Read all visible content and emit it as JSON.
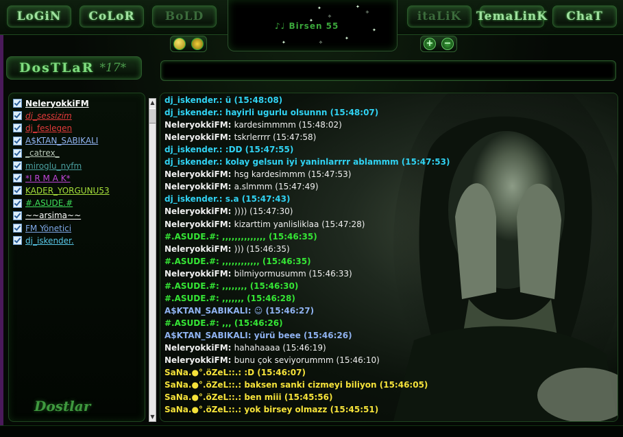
{
  "toolbar": {
    "login": "LoGiN",
    "color": "CoLoR",
    "bold": "BoLD",
    "italic": "itaLiK",
    "theme": "TemaLinK",
    "chat": "ChaT"
  },
  "logo": {
    "title": "♪♩ Birsen 55"
  },
  "room": {
    "label": "DosTLaR",
    "count": "*17*"
  },
  "message_input": {
    "value": ""
  },
  "brand": "Dostlar",
  "users": [
    {
      "name": "NeleryokkiFM",
      "color": "#ffffff",
      "bold": true
    },
    {
      "name": "dj_sessizim",
      "color": "#e23a3a",
      "italic": true
    },
    {
      "name": "dj_feslegen",
      "color": "#e23a3a"
    },
    {
      "name": "A$KTAN_SABIKALI",
      "color": "#8fb2f0"
    },
    {
      "name": "_catrex_",
      "color": "#b8c8b8"
    },
    {
      "name": "miroglu_nyfm",
      "color": "#4aa0a0"
    },
    {
      "name": "*I R M A K*",
      "color": "#c046d8"
    },
    {
      "name": "KADER_YORGUNU53",
      "color": "#a6e03a"
    },
    {
      "name": "#.ASUDE.#",
      "color": "#3ee05a"
    },
    {
      "name": "~~arsima~~",
      "color": "#ffffff"
    },
    {
      "name": "FM Yönetici",
      "color": "#7fa8e8"
    },
    {
      "name": "dj_iskender.",
      "color": "#58c8e8"
    }
  ],
  "messages": [
    {
      "user": "dj_iskender.:",
      "text": "ü (15:48:08)",
      "color": "#30d2f2"
    },
    {
      "user": "dj_iskender.:",
      "text": "hayirli ugurlu olsunnn (15:48:07)",
      "color": "#30d2f2"
    },
    {
      "user": "NeleryokkiFM:",
      "text": "kardesimmmm (15:48:02)",
      "color": "#f0f0f0"
    },
    {
      "user": "NeleryokkiFM:",
      "text": "tskrlerrrr (15:47:58)",
      "color": "#f0f0f0"
    },
    {
      "user": "dj_iskender.:",
      "text": ":DD (15:47:55)",
      "color": "#30d2f2"
    },
    {
      "user": "dj_iskender.:",
      "text": "kolay gelsun iyi yaninlarrrr ablammm (15:47:53)",
      "color": "#30d2f2"
    },
    {
      "user": "NeleryokkiFM:",
      "text": "hsg kardesimmm (15:47:53)",
      "color": "#f0f0f0"
    },
    {
      "user": "NeleryokkiFM:",
      "text": "a.slmmm (15:47:49)",
      "color": "#f0f0f0"
    },
    {
      "user": "dj_iskender.:",
      "text": "s.a (15:47:43)",
      "color": "#30d2f2"
    },
    {
      "user": "NeleryokkiFM:",
      "text": ")))) (15:47:30)",
      "color": "#f0f0f0"
    },
    {
      "user": "NeleryokkiFM:",
      "text": "kizarttim yanlisliklaa (15:47:28)",
      "color": "#f0f0f0"
    },
    {
      "user": "#.ASUDE.#:",
      "text": ",,,,,,,,,,,,,, (15:46:35)",
      "color": "#35e535"
    },
    {
      "user": "NeleryokkiFM:",
      "text": "))) (15:46:35)",
      "color": "#f0f0f0"
    },
    {
      "user": "#.ASUDE.#:",
      "text": ",,,,,,,,,,,, (15:46:35)",
      "color": "#35e535"
    },
    {
      "user": "NeleryokkiFM:",
      "text": "bilmiyormusumm (15:46:33)",
      "color": "#f0f0f0"
    },
    {
      "user": "#.ASUDE.#:",
      "text": ",,,,,,,, (15:46:30)",
      "color": "#35e535"
    },
    {
      "user": "#.ASUDE.#:",
      "text": ",,,,,,, (15:46:28)",
      "color": "#35e535"
    },
    {
      "user": "A$KTAN_SABIKALI:",
      "text": "☺ (15:46:27)",
      "color": "#8fb2f0"
    },
    {
      "user": "#.ASUDE.#:",
      "text": ",,, (15:46:26)",
      "color": "#35e535"
    },
    {
      "user": "A$KTAN_SABIKALI:",
      "text": "yürü beee (15:46:26)",
      "color": "#8fb2f0"
    },
    {
      "user": "NeleryokkiFM:",
      "text": "hahahaaaa (15:46:19)",
      "color": "#f0f0f0"
    },
    {
      "user": "NeleryokkiFM:",
      "text": "bunu çok seviyorummm (15:46:10)",
      "color": "#f0f0f0"
    },
    {
      "user": "SaNa.●°.öZeL::.:",
      "text": ":D (15:46:07)",
      "color": "#f5e23a"
    },
    {
      "user": "SaNa.●°.öZeL::.:",
      "text": "baksen sanki cizmeyi biliyon (15:46:05)",
      "color": "#f5e23a"
    },
    {
      "user": "SaNa.●°.öZeL::.:",
      "text": "ben miii (15:45:56)",
      "color": "#f5e23a"
    },
    {
      "user": "SaNa.●°.öZeL::.:",
      "text": "yok birsey olmazz (15:45:51)",
      "color": "#f5e23a"
    }
  ]
}
